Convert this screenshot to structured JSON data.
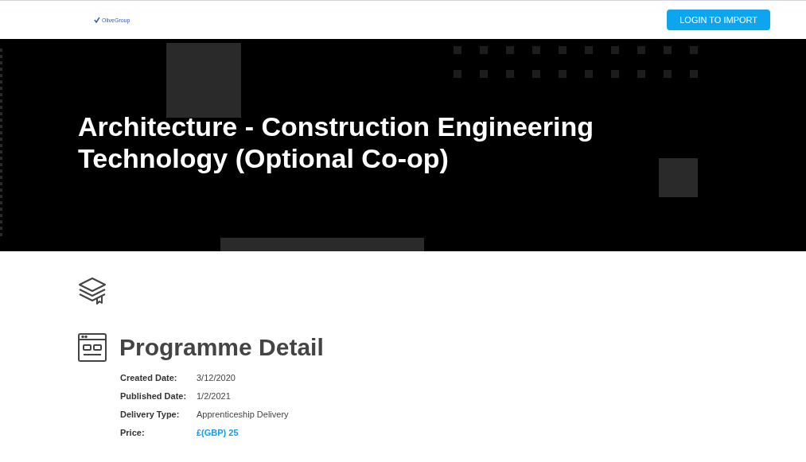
{
  "header": {
    "logo_text": "OliveGroup",
    "login_button": "LOGIN TO IMPORT"
  },
  "hero": {
    "title": "Architecture - Construction Engineering Technology (Optional Co-op)"
  },
  "section": {
    "heading": "Programme Detail",
    "details": [
      {
        "label": "Created Date:",
        "value": "3/12/2020",
        "kind": "text"
      },
      {
        "label": "Published Date:",
        "value": "1/2/2021",
        "kind": "text"
      },
      {
        "label": "Delivery Type:",
        "value": "Apprenticeship Delivery",
        "kind": "text"
      },
      {
        "label": "Price:",
        "value": "£(GBP) 25",
        "kind": "price"
      }
    ]
  }
}
